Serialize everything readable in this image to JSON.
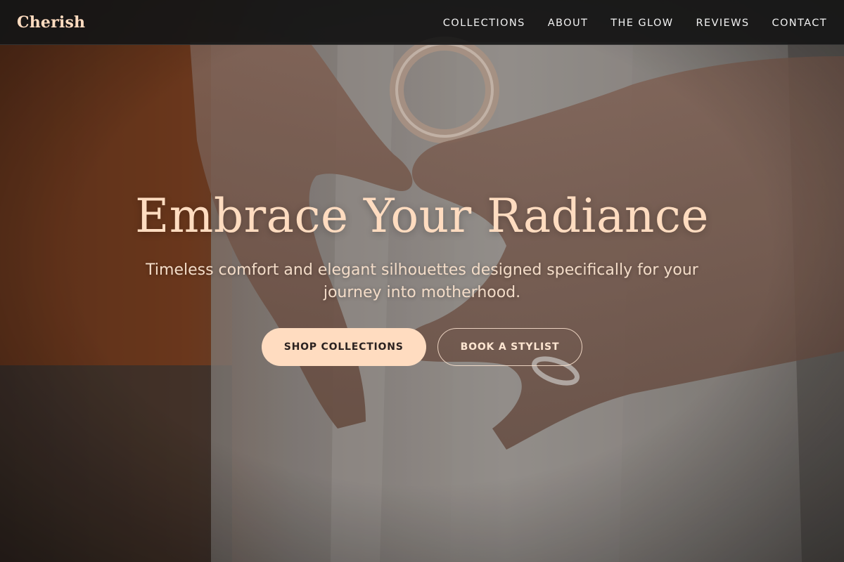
{
  "brand": {
    "name": "Cherish"
  },
  "nav": {
    "items": [
      {
        "label": "COLLECTIONS"
      },
      {
        "label": "ABOUT"
      },
      {
        "label": "THE GLOW"
      },
      {
        "label": "REVIEWS"
      },
      {
        "label": "CONTACT"
      }
    ]
  },
  "hero": {
    "headline": "Embrace Your Radiance",
    "subheadline": "Timeless comfort and elegant silhouettes designed specifically for your journey into motherhood.",
    "primary_cta": "SHOP COLLECTIONS",
    "secondary_cta": "BOOK A STYLIST"
  },
  "colors": {
    "accent": "#ffdcc0",
    "nav_background": "#161616",
    "nav_text": "#f2f2f2",
    "button_text": "#2b2220"
  },
  "icons": {
    "hero_image": "pregnant-hands-heart-photo"
  }
}
